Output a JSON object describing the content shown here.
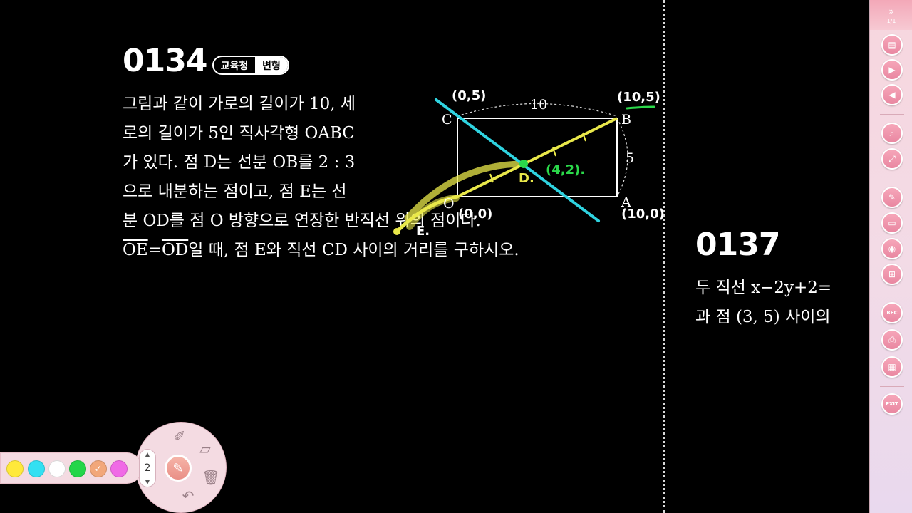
{
  "problem1": {
    "number": "0134",
    "badge_left": "교육청",
    "badge_right": "변형",
    "lines": [
      "그림과 같이 가로의 길이가 10, 세",
      "로의 길이가 5인 직사각형 OABC",
      "가 있다. 점 D는 선분 OB를 2 : 3",
      "으로 내분하는 점이고, 점 E는 선",
      "분 OD를 점 O 방향으로 연장한 반직선 위의 점이다."
    ],
    "last_line": {
      "oe": "OE",
      "eq": "=",
      "od": "OD",
      "rest": "일 때, 점 E와 직선 CD 사이의 거리를 구하시오."
    }
  },
  "figure": {
    "labels": {
      "C": "C",
      "B": "B",
      "A": "A",
      "O": "O",
      "D": "D.",
      "E": "E."
    },
    "dims": {
      "width": "10",
      "height": "5"
    },
    "annotations": {
      "c_coord": "(0,5)",
      "b_coord": "(10,5)",
      "o_coord": "(0,0)",
      "a_coord": "(10,0)",
      "d_coord": "(4,2)."
    },
    "colors": {
      "cyan": "#2fd3e0",
      "yellow": "#e9e84a",
      "green": "#2bd84a"
    }
  },
  "problem2": {
    "number": "0137",
    "line1": "두 직선 x−2y+2=",
    "line2": "과 점 (3, 5) 사이의"
  },
  "sidebar": {
    "top_chevron": "»",
    "page": "1/1",
    "buttons": [
      "pdf-icon",
      "play-icon",
      "back-icon",
      "zoom-icon",
      "fit-icon",
      "pen-icon",
      "board-icon",
      "capture-icon",
      "windows-icon",
      "rec",
      "print-icon",
      "share-icon",
      "exit"
    ],
    "rec_label": "REC",
    "exit_label": "EXIT"
  },
  "pen_tool": {
    "colors": [
      "#ffe93b",
      "#33e0f2",
      "#ffffff",
      "#24d64a",
      "#f2a77a",
      "#f06ae6"
    ],
    "selected_color_index": 4,
    "pen_size": "2"
  }
}
